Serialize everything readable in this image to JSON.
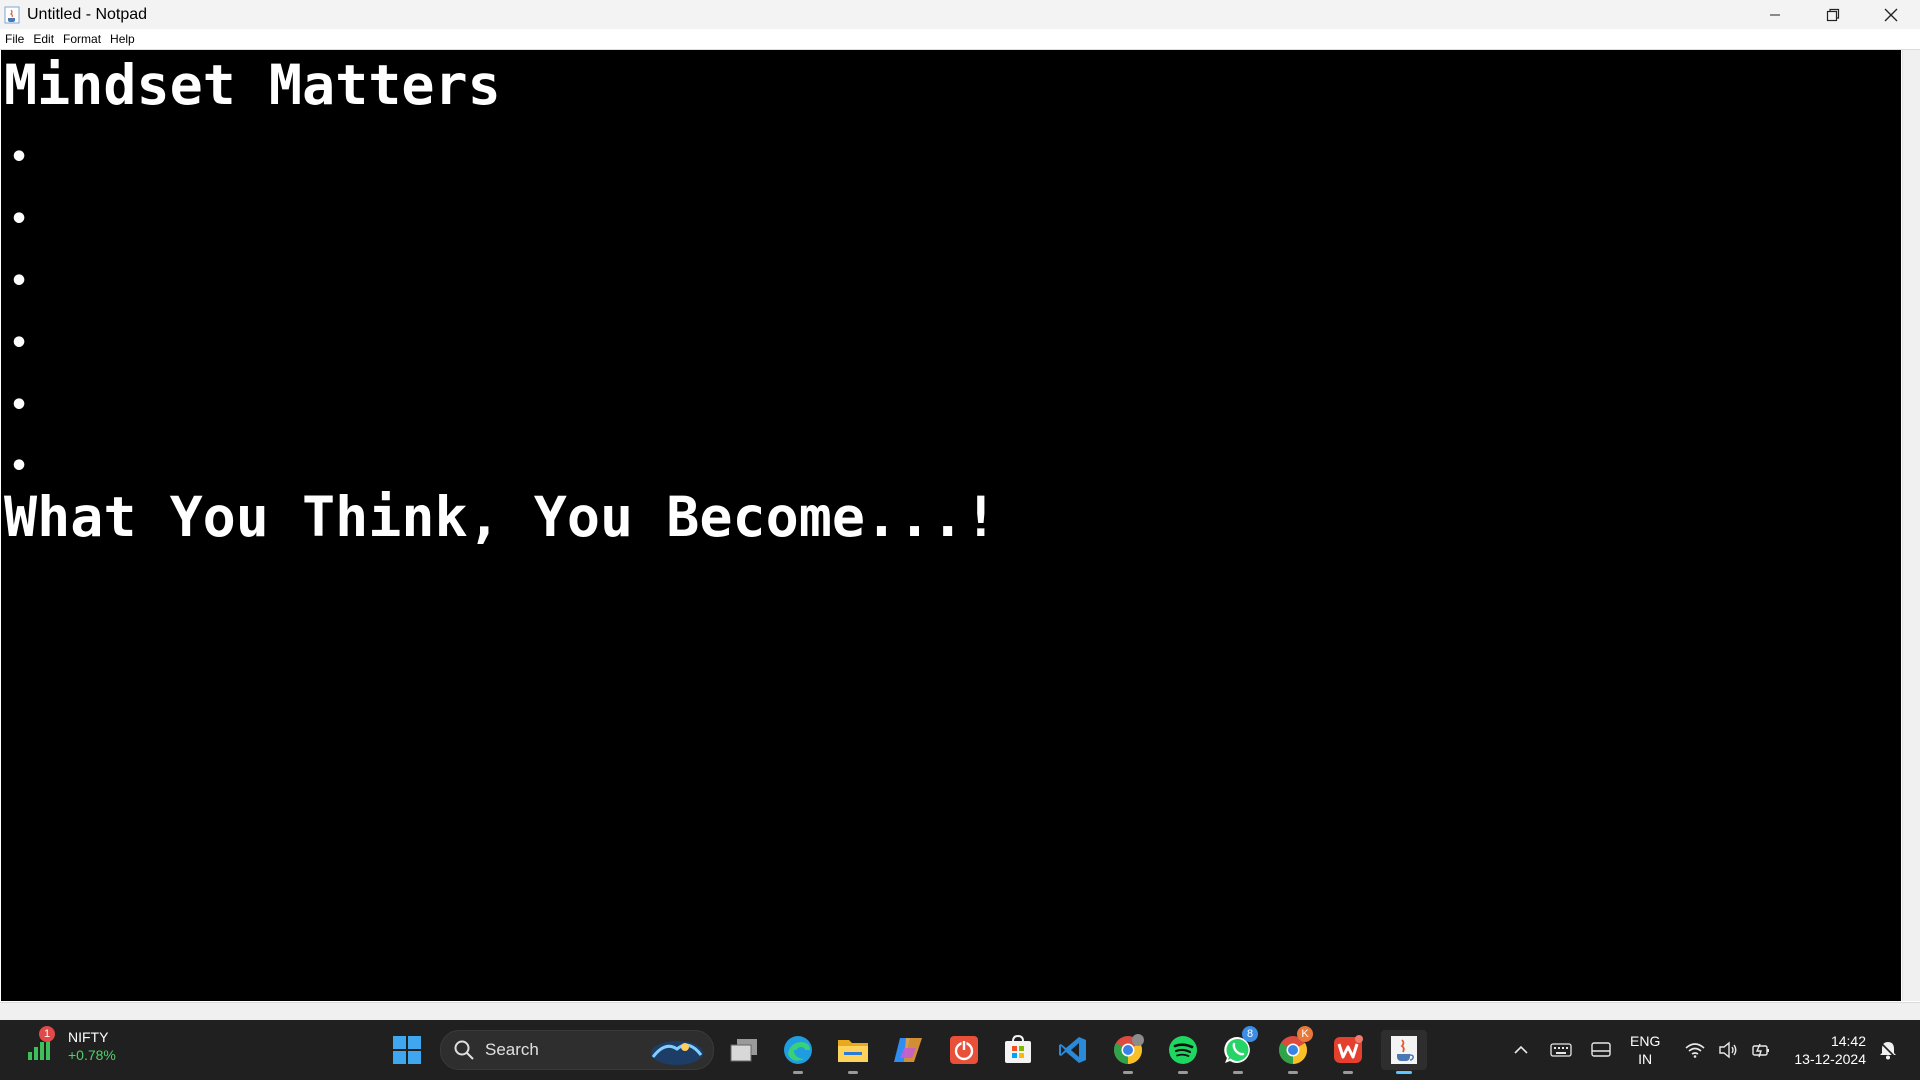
{
  "window": {
    "title": "Untitled - Notpad",
    "icon": "java-cup-icon"
  },
  "menu": {
    "items": [
      "File",
      "Edit",
      "Format",
      "Help"
    ]
  },
  "editor": {
    "heading": "Mindset Matters",
    "bullets": [
      "•",
      "•",
      "•",
      "•",
      "•",
      "•"
    ],
    "quote": "What You Think, You Become...!",
    "background": "#000000",
    "text_color": "#ffffff"
  },
  "taskbar": {
    "widget": {
      "name": "NIFTY",
      "change": "+0.78%",
      "badge": "1"
    },
    "search": {
      "label": "Search"
    },
    "apps": [
      {
        "name": "start-button",
        "running": false
      },
      {
        "name": "task-view",
        "running": false
      },
      {
        "name": "edge",
        "running": true
      },
      {
        "name": "file-explorer",
        "running": true
      },
      {
        "name": "copilot",
        "running": false
      },
      {
        "name": "power-app",
        "running": false
      },
      {
        "name": "microsoft-store",
        "running": false
      },
      {
        "name": "vs-code",
        "running": false
      },
      {
        "name": "chrome-profile-1",
        "running": true
      },
      {
        "name": "spotify",
        "running": true
      },
      {
        "name": "whatsapp",
        "running": true,
        "badge": "8"
      },
      {
        "name": "chrome-profile-2",
        "running": true,
        "badge": "K"
      },
      {
        "name": "wps-office",
        "running": true
      },
      {
        "name": "java-notpad",
        "running": true,
        "active": true
      }
    ],
    "language": {
      "line1": "ENG",
      "line2": "IN"
    },
    "clock": {
      "time": "14:42",
      "date": "13-12-2024"
    }
  }
}
